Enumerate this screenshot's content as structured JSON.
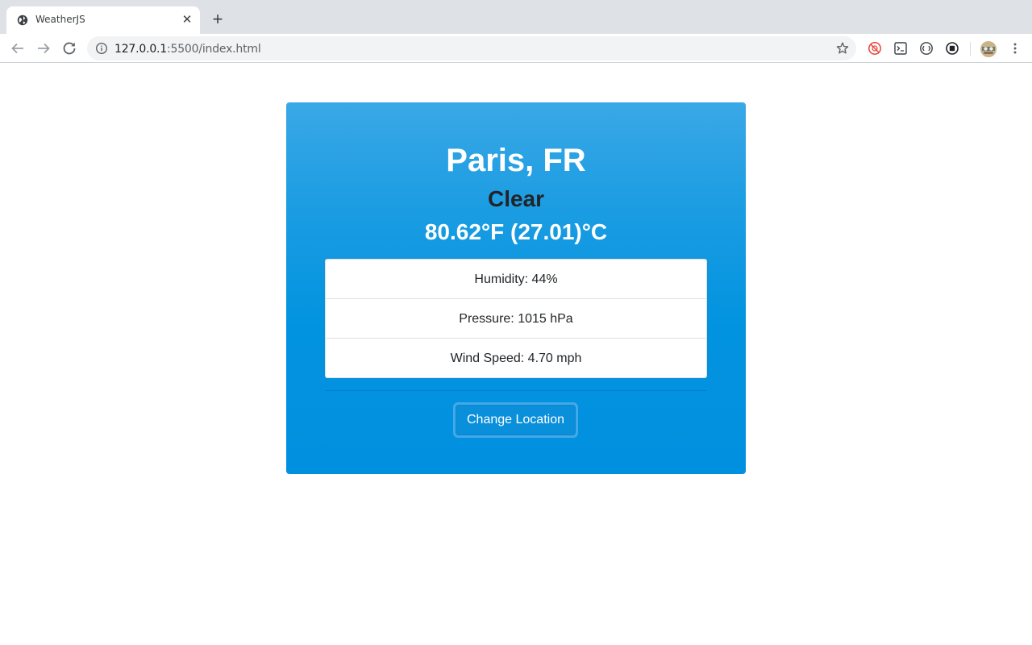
{
  "browser": {
    "tab_title": "WeatherJS",
    "url_host": "127.0.0.1",
    "url_path": ":5500/index.html",
    "icons": [
      "globe-icon",
      "close-icon",
      "plus-icon",
      "back-icon",
      "forward-icon",
      "reload-icon",
      "info-icon",
      "star-icon",
      "extension-icon",
      "profile-avatar",
      "menu-icon"
    ]
  },
  "weather": {
    "location": "Paris, FR",
    "description": "Clear",
    "temperature": "80.62°F (27.01)°C",
    "details": [
      {
        "label": "Humidity: 44%"
      },
      {
        "label": "Pressure: 1015 hPa"
      },
      {
        "label": "Wind Speed: 4.70 mph"
      }
    ],
    "change_location_label": "Change Location"
  },
  "colors": {
    "card_top": "#3aa8e6",
    "card_bottom": "#0190df",
    "button": "#0a8fdb"
  }
}
